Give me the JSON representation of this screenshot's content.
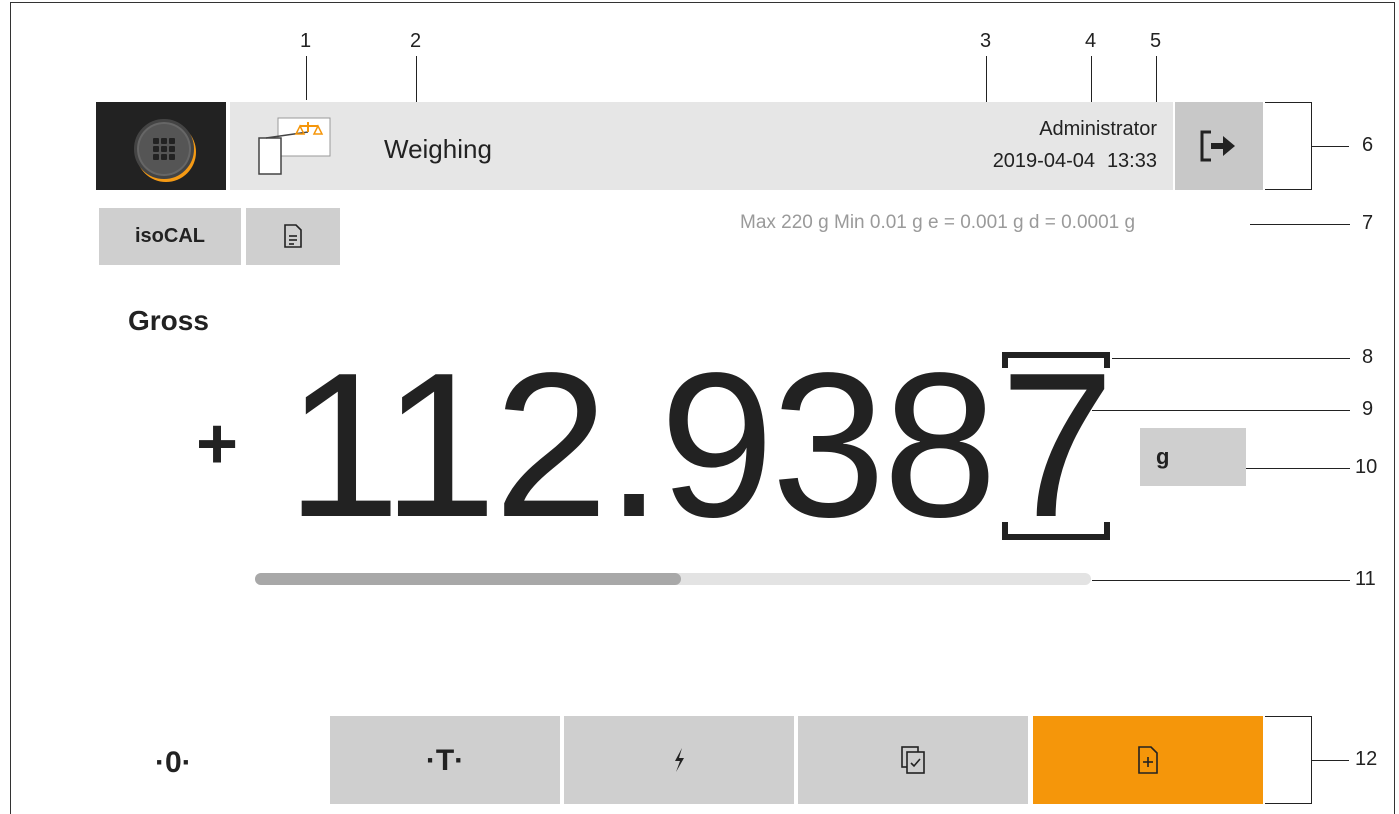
{
  "callouts": [
    "1",
    "2",
    "3",
    "4",
    "5",
    "6",
    "7",
    "8",
    "9",
    "10",
    "11",
    "12"
  ],
  "header": {
    "app_title": "Weighing",
    "user": "Administrator",
    "date": "2019-04-04",
    "time": "13:33"
  },
  "toolbar": {
    "isocal_label": "isoCAL",
    "specs": "Max 220 g  Min 0.01 g  e = 0.001 g  d = 0.0001 g"
  },
  "display": {
    "mode": "Gross",
    "sign": "+",
    "value_main": "112.938",
    "value_last_digit": "7",
    "unit": "g",
    "capacity_fraction": 0.51
  },
  "function_keys": {
    "zero_label": "·0·",
    "tare_label": "·T·"
  },
  "colors": {
    "accent": "#f5960a",
    "header_bg": "#e6e6e6",
    "button_bg": "#cfcfcf"
  },
  "icons": [
    "apps-grid-icon",
    "weighing-app-icon",
    "logout-icon",
    "document-icon",
    "flash-icon",
    "copy-check-icon",
    "add-document-icon"
  ]
}
